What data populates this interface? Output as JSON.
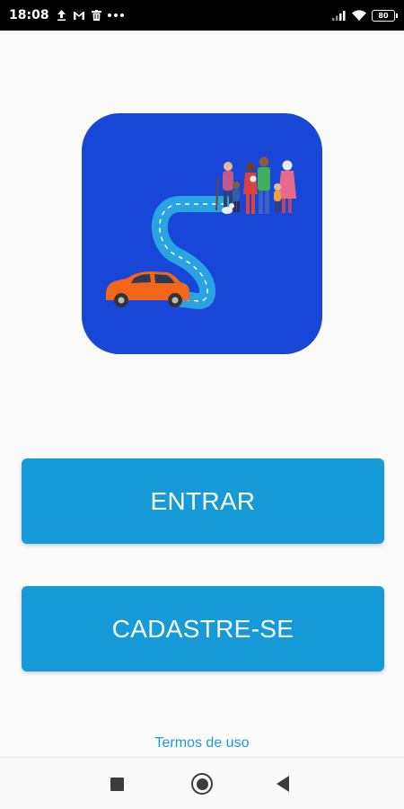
{
  "status_bar": {
    "time": "18:08",
    "battery": "80",
    "icons": [
      "upload-icon",
      "gmail-icon",
      "trash-icon",
      "more-icon",
      "signal-icon",
      "wifi-icon",
      "battery-icon"
    ]
  },
  "app_icon": {
    "background_color": "#1846d6",
    "road_color": "#2aa3e3",
    "car_color": "#f2661a"
  },
  "actions": {
    "login_label": "ENTRAR",
    "signup_label": "CADASTRE-SE",
    "terms_label": "Termos de uso"
  },
  "colors": {
    "button": "#169ad8",
    "link": "#1a9ad6"
  },
  "nav_bar": {
    "icons": [
      "square-icon",
      "home-circle-icon",
      "back-triangle-icon"
    ]
  }
}
